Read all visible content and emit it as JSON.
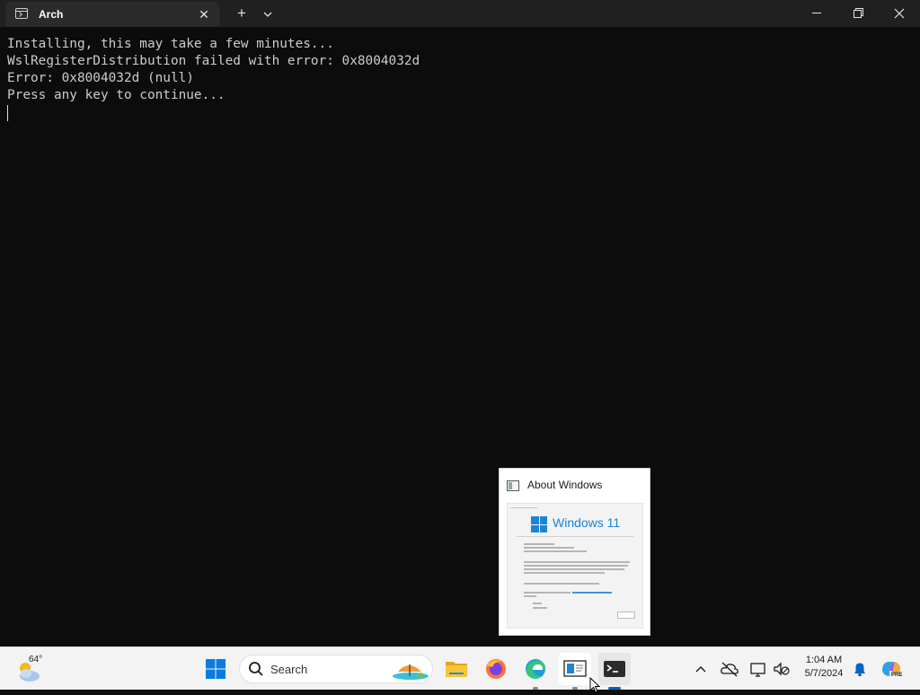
{
  "window": {
    "tab_title": "Arch",
    "icons": {
      "tab": "terminal-icon",
      "close_tab": "close-icon",
      "new_tab": "plus-icon",
      "dropdown": "chevron-down-icon",
      "minimize": "minimize-icon",
      "maximize": "restore-icon",
      "close": "close-icon"
    }
  },
  "terminal": {
    "lines": [
      "Installing, this may take a few minutes...",
      "WslRegisterDistribution failed with error: 0x8004032d",
      "Error: 0x8004032d (null)",
      "Press any key to continue..."
    ]
  },
  "preview": {
    "title": "About Windows",
    "logo_text": "Windows 11"
  },
  "taskbar": {
    "weather": {
      "temp": "64°",
      "icon": "partly-cloudy-icon"
    },
    "search_label": "Search",
    "apps": [
      "start-icon",
      "search-icon",
      "file-explorer-icon",
      "firefox-icon",
      "edge-icon",
      "winver-icon",
      "terminal-icon"
    ],
    "clock": {
      "time": "1:04 AM",
      "date": "5/7/2024"
    },
    "colors": {
      "accent": "#0067c0",
      "terminal_bg": "#0c0c0c",
      "titlebar": "#202020"
    }
  }
}
